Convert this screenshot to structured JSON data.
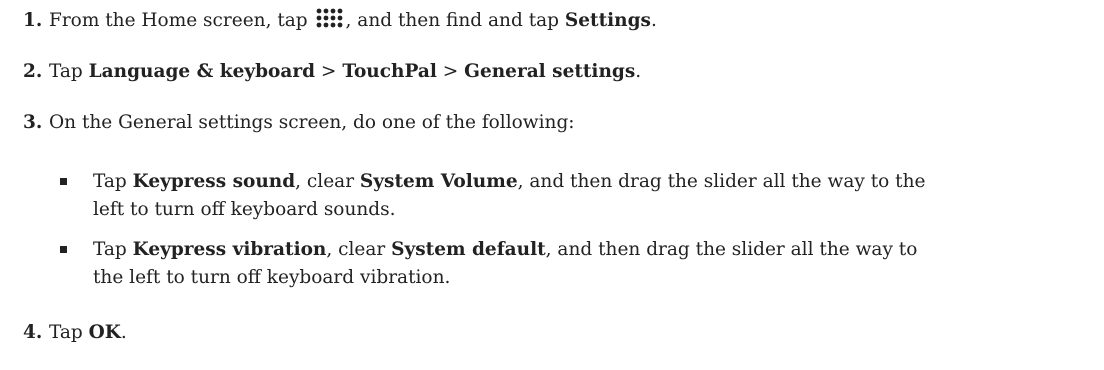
{
  "steps": [
    {
      "number": "1.",
      "before_icon": "From the Home screen, tap ",
      "icon": "apps-grid-icon",
      "after_icon": ", and then find and tap ",
      "bold": "Settings",
      "end": "."
    },
    {
      "number": "2.",
      "text_a": "Tap ",
      "bold_a": "Language & keyboard",
      "sep_a": " > ",
      "bold_b": "TouchPal",
      "sep_b": " > ",
      "bold_c": "General settings",
      "end": "."
    },
    {
      "number": "3.",
      "text": "On the General settings screen, do one of the following:",
      "bullets": [
        {
          "t1": "Tap ",
          "b1": "Keypress sound",
          "t2": ", clear ",
          "b2": "System Volume",
          "t3": ", and then drag the slider all the way to the",
          "t4": "left to turn off keyboard sounds."
        },
        {
          "t1": "Tap ",
          "b1": "Keypress vibration",
          "t2": ", clear ",
          "b2": "System default",
          "t3": ", and then drag the slider all the way to",
          "t4": "the left to turn off keyboard vibration."
        }
      ]
    },
    {
      "number": "4.",
      "text": "Tap ",
      "bold": "OK",
      "end": "."
    }
  ]
}
